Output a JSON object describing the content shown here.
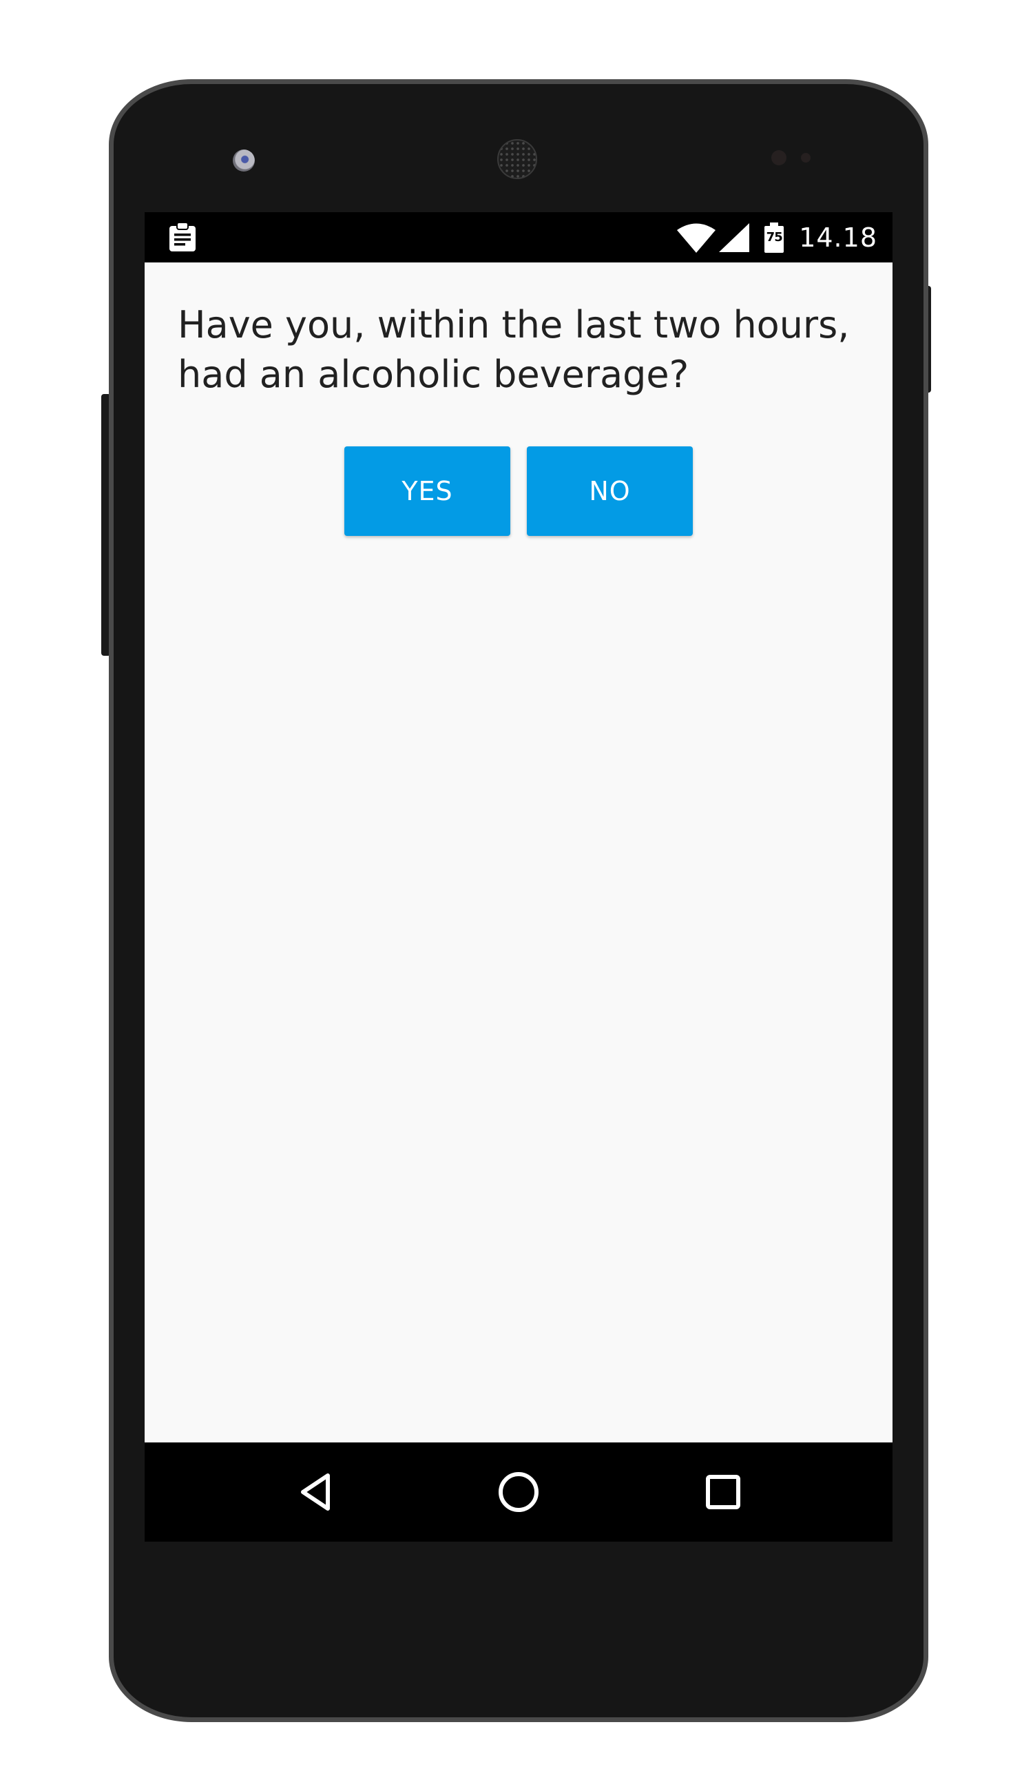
{
  "status_bar": {
    "notification_icon": "clipboard-icon",
    "wifi_icon": "wifi-icon",
    "signal_icon": "cell-signal-icon",
    "battery_icon": "battery-icon",
    "battery_level": "75",
    "time": "14.18"
  },
  "question": {
    "text": "Have you, within the last two hours, had an alcoholic beverage?"
  },
  "answers": {
    "yes_label": "YES",
    "no_label": "NO",
    "button_color": "#039be5"
  },
  "nav_bar": {
    "back_icon": "back-triangle-icon",
    "home_icon": "home-circle-icon",
    "recents_icon": "recents-square-icon"
  },
  "colors": {
    "screen_background": "#f9f9f9",
    "bar_background": "#000000",
    "text_primary": "#212121"
  }
}
